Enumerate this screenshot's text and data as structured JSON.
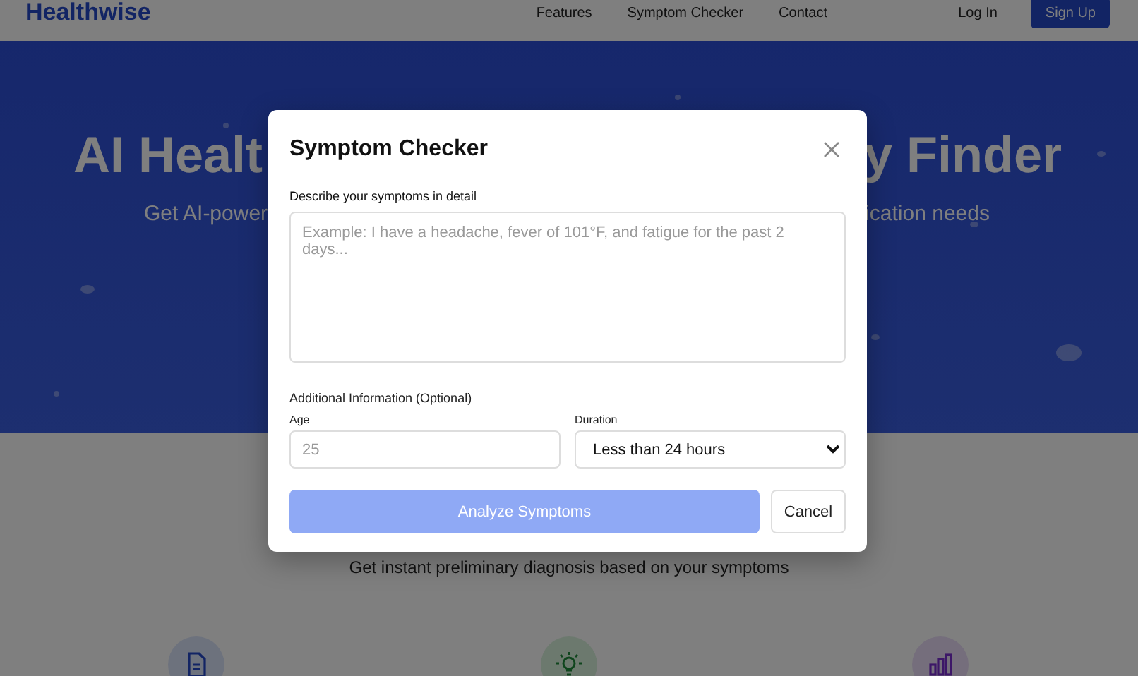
{
  "nav": {
    "logo": "Healthwise",
    "links": [
      "Features",
      "Symptom Checker",
      "Contact"
    ],
    "login": "Log In",
    "signup": "Sign Up"
  },
  "hero": {
    "title_left": "AI Healt",
    "title_right": "y Finder",
    "subtitle_left": "Get AI-power",
    "subtitle_right": "ication needs"
  },
  "section": {
    "subtitle": "Get instant preliminary diagnosis based on your symptoms"
  },
  "modal": {
    "title": "Symptom Checker",
    "symptoms_label": "Describe your symptoms in detail",
    "symptoms_placeholder": "Example: I have a headache, fever of 101°F, and fatigue for the past 2 days...",
    "additional_label": "Additional Information (Optional)",
    "age": {
      "label": "Age",
      "placeholder": "25"
    },
    "duration": {
      "label": "Duration",
      "value": "Less than 24 hours"
    },
    "analyze": {
      "label": "Analyze Symptoms",
      "disabled": true
    },
    "cancel": "Cancel"
  }
}
